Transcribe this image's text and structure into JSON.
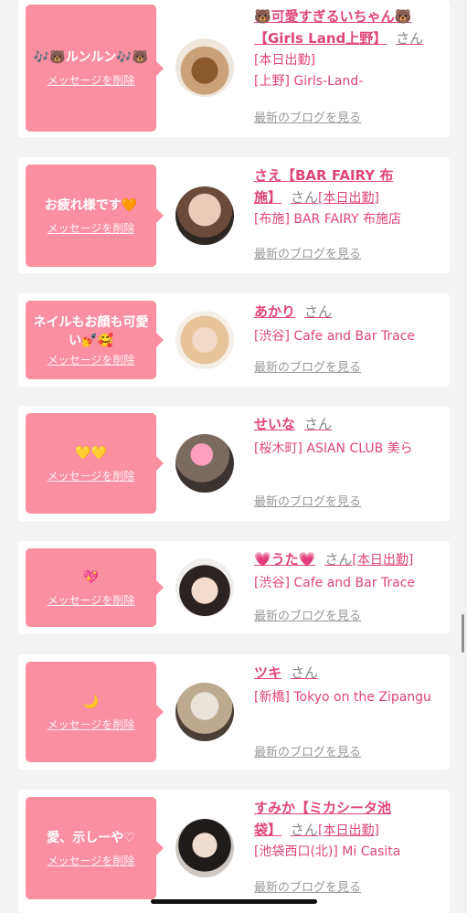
{
  "delete_label": "メッセージを削除",
  "blog_label": "最新のブログを見る",
  "san_label": "さん",
  "colors": {
    "bubble": "#f98fa1",
    "name": "#e0457b",
    "background": "#f3f3f3"
  },
  "cards": [
    {
      "message": "🎶🐻ルンルン🎶🐻",
      "name_line1": "🐻可愛すぎるいちゃん🐻",
      "name_line2": "【Girls Land上野】",
      "attendance": "[本日出勤]",
      "shop": "[上野] Girls-Land-",
      "avatar_icon": "teddy-bear-photo"
    },
    {
      "message": "お疲れ様です🧡",
      "name_line1": "さえ【BAR FAIRY 布",
      "name_line2": "施】",
      "attendance": "[本日出勤]",
      "shop": "[布施] BAR FAIRY 布施店",
      "avatar_icon": "portrait-photo"
    },
    {
      "message": "ネイルもお顔も可愛い💅🥰",
      "name_line1": "あかり",
      "name_line2": "",
      "attendance": "",
      "shop": "[渋谷] Cafe and Bar Trace",
      "avatar_icon": "portrait-photo"
    },
    {
      "message": "💛💛",
      "name_line1": "せいな",
      "name_line2": "",
      "attendance": "",
      "shop": "[桜木町] ASIAN CLUB 美ら",
      "avatar_icon": "portrait-photo"
    },
    {
      "message": "💖",
      "name_line1": "💗うた💗",
      "name_line2": "",
      "attendance": "[本日出勤]",
      "shop": "[渋谷] Cafe and Bar Trace",
      "avatar_icon": "portrait-photo"
    },
    {
      "message": "🌙",
      "name_line1": "ツキ",
      "name_line2": "",
      "attendance": "",
      "shop": "[新橋] Tokyo on the Zipangu",
      "avatar_icon": "portrait-photo"
    },
    {
      "message": "愛、示しーや♡",
      "name_line1": "すみか【ミカシータ池",
      "name_line2": "袋】",
      "attendance": "[本日出勤]",
      "shop": "[池袋西口(北)] Mi Casita",
      "avatar_icon": "portrait-photo"
    }
  ]
}
